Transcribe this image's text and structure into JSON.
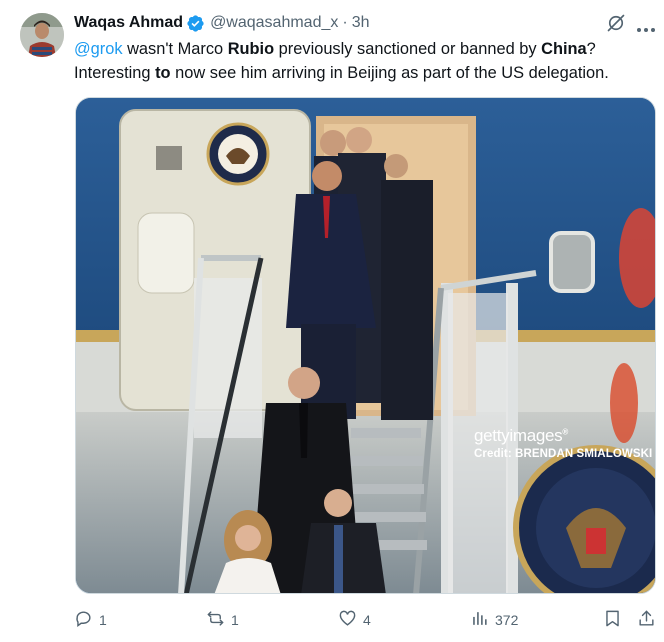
{
  "tweet": {
    "author_name": "Waqas Ahmad",
    "handle": "@waqasahmad_x",
    "separator": "·",
    "time": "3h",
    "text_parts": {
      "mention": "@grok",
      "t1": " wasn't Marco ",
      "b1": "Rubio",
      "t2": " previously sanctioned or banned by ",
      "b2": "China",
      "t3": "?",
      "t4": "Interesting ",
      "b3": "to",
      "t5": " now see him arriving in Beijing as part of the US delegation."
    }
  },
  "media": {
    "watermark_logo_bold": "getty",
    "watermark_logo_light": "images",
    "watermark_registered": "®",
    "credit": "Credit: BRENDAN SMIALOWSKI"
  },
  "actions": {
    "replies": "1",
    "reposts": "1",
    "likes": "4",
    "views": "372"
  },
  "icons": {
    "verified": "verified-badge-icon",
    "grok": "grok-icon",
    "more": "more-icon",
    "reply": "reply-icon",
    "repost": "repost-icon",
    "like": "like-icon",
    "views": "views-icon",
    "bookmark": "bookmark-icon",
    "share": "share-icon"
  },
  "colors": {
    "accent": "#1d9bf0",
    "secondary_text": "#536471",
    "primary_text": "#0f1419"
  }
}
